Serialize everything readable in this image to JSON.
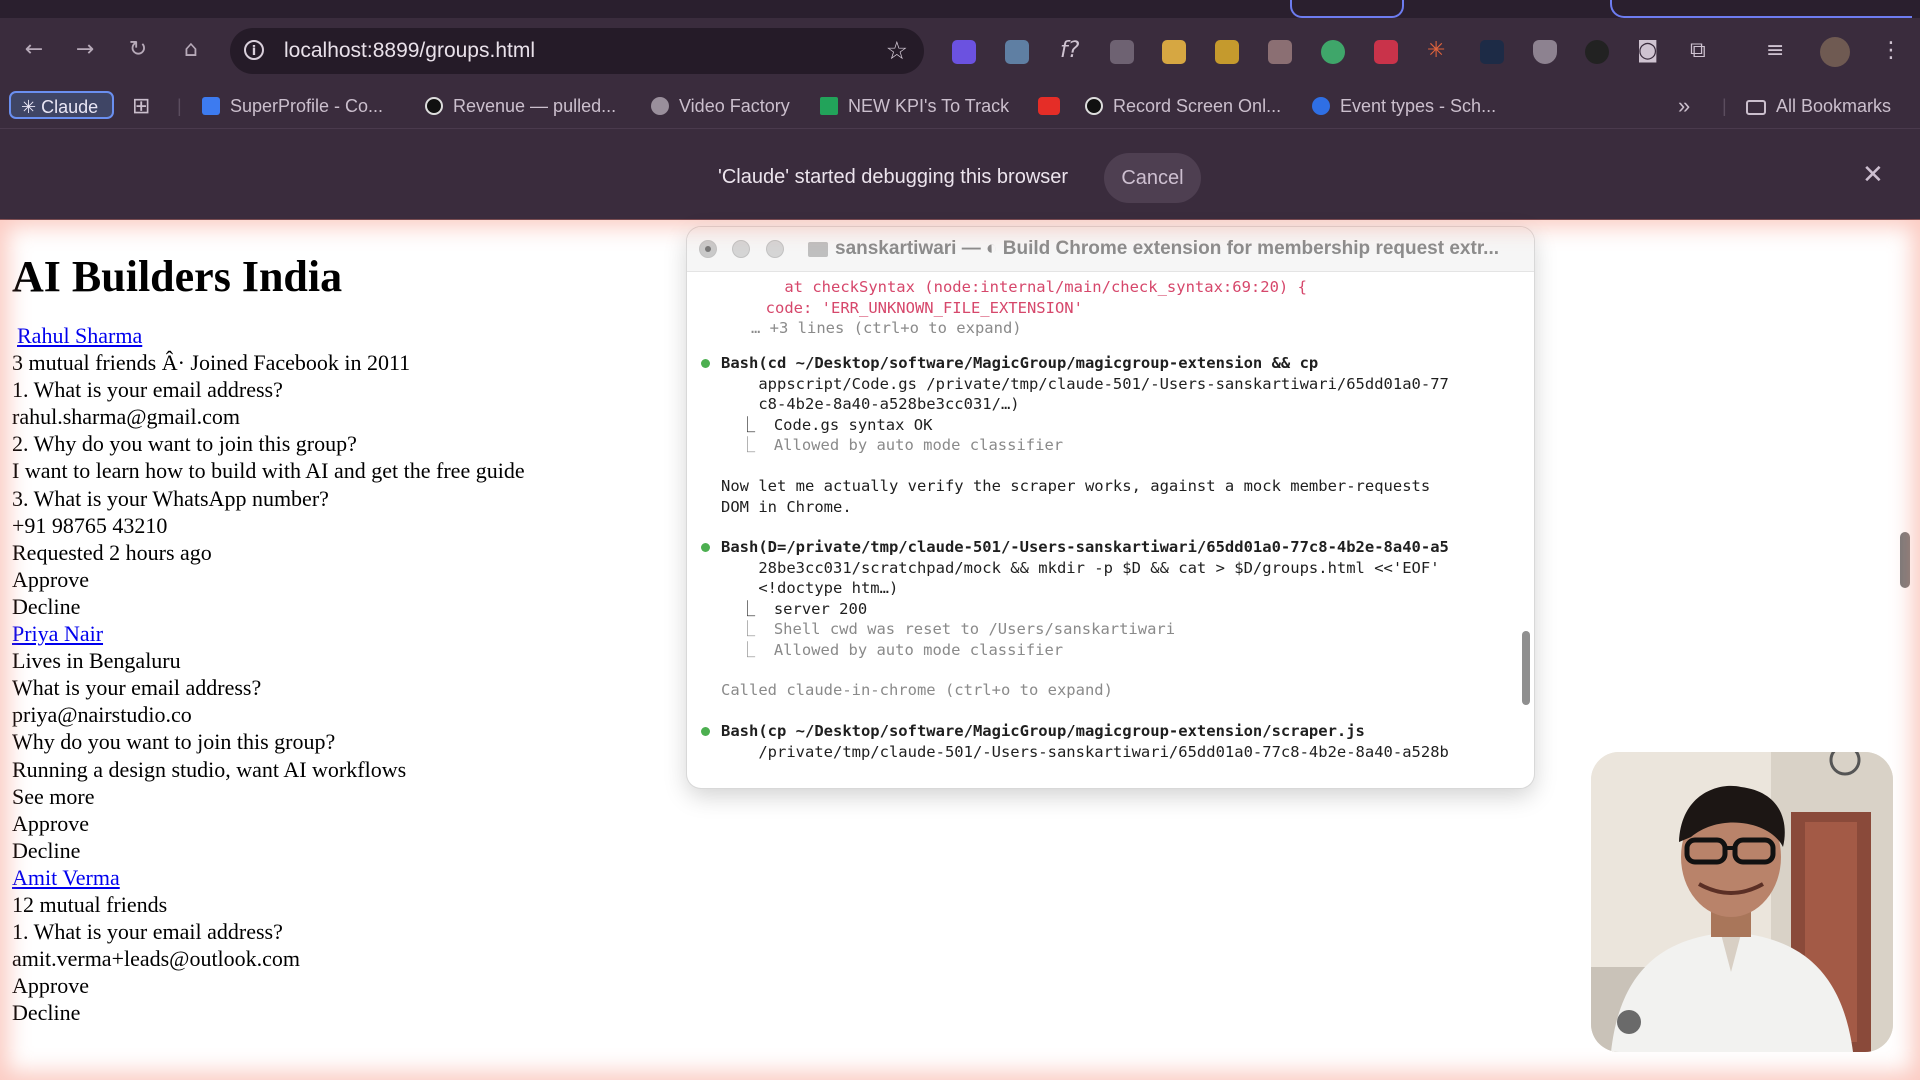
{
  "browser": {
    "url": "localhost:8899/groups.html",
    "bookmarks": [
      {
        "label": "Claude"
      },
      {
        "label": "SuperProfile - Co..."
      },
      {
        "label": "Revenue — pulled..."
      },
      {
        "label": "Video Factory"
      },
      {
        "label": "NEW KPI's To Track"
      },
      {
        "label": "Record Screen Onl..."
      },
      {
        "label": "Event types - Sch..."
      }
    ],
    "all_bookmarks": "All Bookmarks",
    "overflow": "»",
    "infobar_message": "'Claude' started debugging this browser",
    "cancel_label": "Cancel",
    "close_glyph": "✕"
  },
  "page": {
    "title": "AI Builders India",
    "members": [
      {
        "name": "Rahul Sharma",
        "lines": [
          "3 mutual friends Â· Joined Facebook in 2011",
          "1. What is your email address?",
          "rahul.sharma@gmail.com",
          "2. Why do you want to join this group?",
          "I want to learn how to build with AI and get the free guide",
          "3. What is your WhatsApp number?",
          "+91 98765 43210",
          "Requested 2 hours ago"
        ],
        "approve": "Approve",
        "decline": "Decline"
      },
      {
        "name": "Priya Nair",
        "lines": [
          "Lives in Bengaluru",
          "What is your email address?",
          "priya@nairstudio.co",
          "Why do you want to join this group?",
          "Running a design studio, want AI workflows"
        ],
        "see_more": "See more",
        "approve": "Approve",
        "decline": "Decline"
      },
      {
        "name": "Amit Verma",
        "lines": [
          "12 mutual friends",
          "1. What is your email address?",
          "amit.verma+leads@outlook.com"
        ],
        "approve": "Approve",
        "decline": "Decline"
      }
    ]
  },
  "terminal": {
    "title": "sanskartiwari — ◐ Build Chrome extension for membership request extr...",
    "lines": [
      {
        "text": "    at checkSyntax (node:internal/main/check_syntax:69:20) {",
        "style": "err"
      },
      {
        "text": "  code: 'ERR_UNKNOWN_FILE_EXTENSION'",
        "style": "err"
      },
      {
        "text": "… +3 lines (ctrl+o to expand)",
        "style": "dim"
      },
      {
        "text": "Bash(cd ~/Desktop/software/MagicGroup/magicgroup-extension && cp",
        "style": "cmd"
      },
      {
        "text": "    appscript/Code.gs /private/tmp/claude-501/-Users-sanskartiwari/65dd01a0-77",
        "style": "plain"
      },
      {
        "text": "    c8-4b2e-8a40-a528be3cc031/…)",
        "style": "plain"
      },
      {
        "text": "  ⎿  Code.gs syntax OK",
        "style": "plain"
      },
      {
        "text": "  ⎿  Allowed by auto mode classifier",
        "style": "dim"
      },
      {
        "text": "Now let me actually verify the scraper works, against a mock member-requests",
        "style": "plain"
      },
      {
        "text": "DOM in Chrome.",
        "style": "plain"
      },
      {
        "text": "Bash(D=/private/tmp/claude-501/-Users-sanskartiwari/65dd01a0-77c8-4b2e-8a40-a5",
        "style": "cmd"
      },
      {
        "text": "    28be3cc031/scratchpad/mock && mkdir -p $D && cat > $D/groups.html <<'EOF'",
        "style": "plain"
      },
      {
        "text": "    <!doctype htm…)",
        "style": "plain"
      },
      {
        "text": "  ⎿  server 200",
        "style": "plain"
      },
      {
        "text": "  ⎿  Shell cwd was reset to /Users/sanskartiwari",
        "style": "dim"
      },
      {
        "text": "  ⎿  Allowed by auto mode classifier",
        "style": "dim"
      },
      {
        "text": "Called claude-in-chrome (ctrl+o to expand)",
        "style": "dim"
      },
      {
        "text": "Bash(cp ~/Desktop/software/MagicGroup/magicgroup-extension/scraper.js",
        "style": "cmd"
      },
      {
        "text": "    /private/tmp/claude-501/-Users-sanskartiwari/65dd01a0-77c8-4b2e-8a40-a528b",
        "style": "plain"
      }
    ]
  },
  "colors": {
    "chrome_bg": "#3a2c3d",
    "link": "#0000ee",
    "error_text": "#d6476b",
    "bullet_green": "#4caf50"
  }
}
